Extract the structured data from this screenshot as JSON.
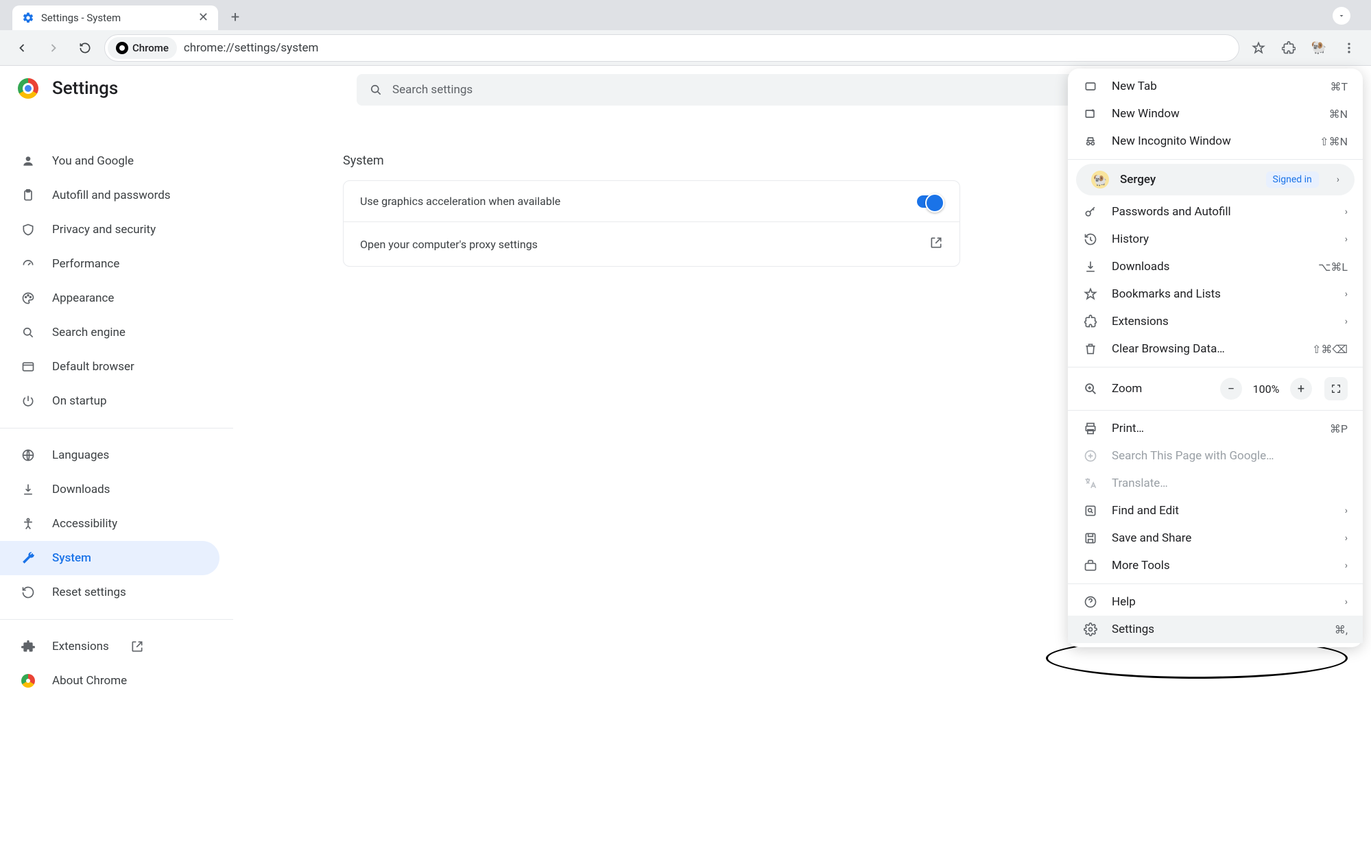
{
  "tab": {
    "title": "Settings - System"
  },
  "omnibox": {
    "chip": "Chrome",
    "url": "chrome://settings/system"
  },
  "header": {
    "title": "Settings"
  },
  "search": {
    "placeholder": "Search settings"
  },
  "sidebar": {
    "items": [
      {
        "label": "You and Google"
      },
      {
        "label": "Autofill and passwords"
      },
      {
        "label": "Privacy and security"
      },
      {
        "label": "Performance"
      },
      {
        "label": "Appearance"
      },
      {
        "label": "Search engine"
      },
      {
        "label": "Default browser"
      },
      {
        "label": "On startup"
      }
    ],
    "secondary": [
      {
        "label": "Languages"
      },
      {
        "label": "Downloads"
      },
      {
        "label": "Accessibility"
      },
      {
        "label": "System"
      },
      {
        "label": "Reset settings"
      }
    ],
    "footer": [
      {
        "label": "Extensions"
      },
      {
        "label": "About Chrome"
      }
    ]
  },
  "section": {
    "title": "System",
    "rows": [
      {
        "label": "Use graphics acceleration when available",
        "toggle": true
      },
      {
        "label": "Open your computer's proxy settings",
        "external": true
      }
    ]
  },
  "menu": {
    "top": [
      {
        "label": "New Tab",
        "shortcut": "⌘T"
      },
      {
        "label": "New Window",
        "shortcut": "⌘N"
      },
      {
        "label": "New Incognito Window",
        "shortcut": "⇧⌘N"
      }
    ],
    "profile": {
      "name": "Sergey",
      "badge": "Signed in"
    },
    "group2": [
      {
        "label": "Passwords and Autofill",
        "sub": true
      },
      {
        "label": "History",
        "sub": true
      },
      {
        "label": "Downloads",
        "shortcut": "⌥⌘L"
      },
      {
        "label": "Bookmarks and Lists",
        "sub": true
      },
      {
        "label": "Extensions",
        "sub": true
      },
      {
        "label": "Clear Browsing Data…",
        "shortcut": "⇧⌘⌫"
      }
    ],
    "zoom": {
      "label": "Zoom",
      "value": "100%"
    },
    "group3": [
      {
        "label": "Print…",
        "shortcut": "⌘P"
      },
      {
        "label": "Search This Page with Google…",
        "disabled": true
      },
      {
        "label": "Translate…",
        "disabled": true
      },
      {
        "label": "Find and Edit",
        "sub": true
      },
      {
        "label": "Save and Share",
        "sub": true
      },
      {
        "label": "More Tools",
        "sub": true
      }
    ],
    "group4": [
      {
        "label": "Help",
        "sub": true
      },
      {
        "label": "Settings",
        "shortcut": "⌘,"
      }
    ]
  }
}
